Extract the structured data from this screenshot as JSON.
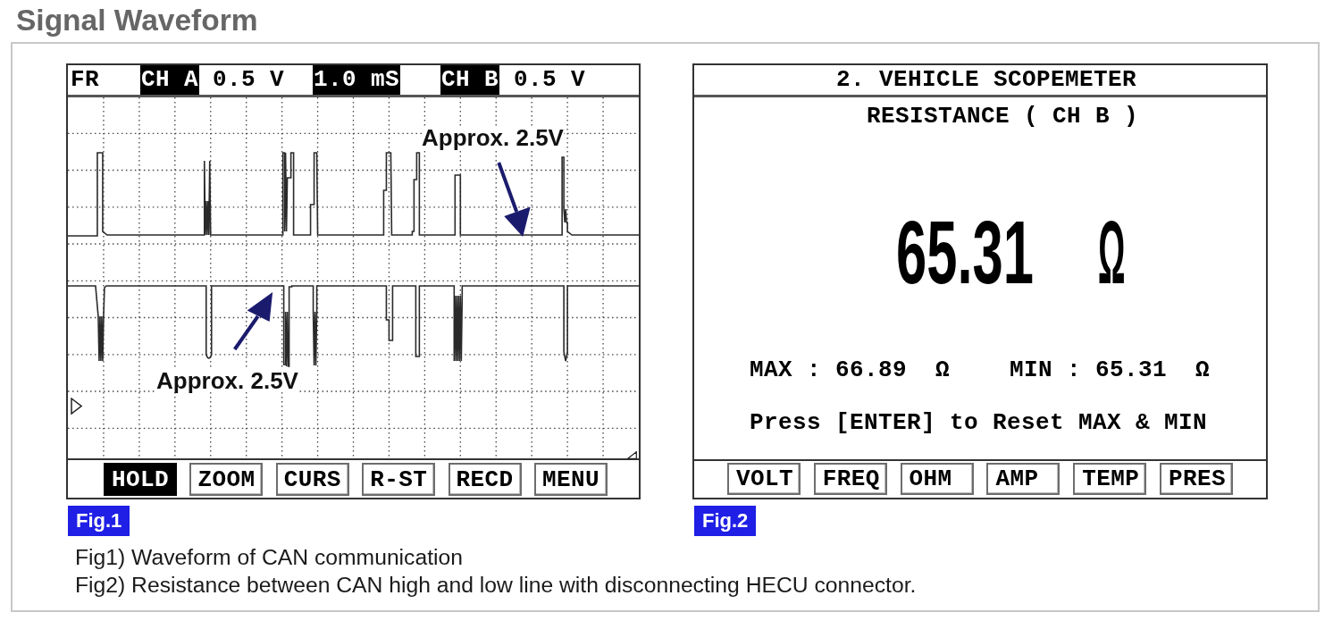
{
  "title": "Signal Waveform",
  "figures": [
    {
      "kind": "oscilloscope",
      "header": [
        {
          "text": "FR",
          "highlighted": false
        },
        {
          "text": "CH A",
          "highlighted": true
        },
        {
          "text": "0.5 V",
          "highlighted": false
        },
        {
          "text": "1.0 mS",
          "highlighted": true
        },
        {
          "text": "CH B",
          "highlighted": true
        },
        {
          "text": "0.5 V",
          "highlighted": false
        }
      ],
      "annotations": [
        "Approx. 2.5V",
        "Approx. 2.5V"
      ],
      "buttons": [
        {
          "label": "HOLD",
          "selected": true
        },
        {
          "label": "ZOOM",
          "selected": false
        },
        {
          "label": "CURS",
          "selected": false
        },
        {
          "label": "R-ST",
          "selected": false
        },
        {
          "label": "RECD",
          "selected": false
        },
        {
          "label": "MENU",
          "selected": false
        }
      ],
      "label": "Fig.1"
    },
    {
      "kind": "meter",
      "title": "2. VEHICLE SCOPEMETER",
      "mode": "RESISTANCE ( CH B )",
      "reading": "65.31",
      "unit": "Ω",
      "max": "MAX : 66.89  Ω",
      "min": "MIN : 65.31  Ω",
      "hint": "Press [ENTER] to Reset MAX & MIN",
      "buttons": [
        {
          "label": "VOLT",
          "selected": false
        },
        {
          "label": "FREQ",
          "selected": false
        },
        {
          "label": "OHM",
          "selected": false
        },
        {
          "label": "AMP",
          "selected": false
        },
        {
          "label": "TEMP",
          "selected": false
        },
        {
          "label": "PRES",
          "selected": false
        }
      ],
      "label": "Fig.2"
    }
  ],
  "captions": [
    "Fig1) Waveform of CAN communication",
    "Fig2) Resistance between CAN high and low line with disconnecting HECU connector."
  ]
}
